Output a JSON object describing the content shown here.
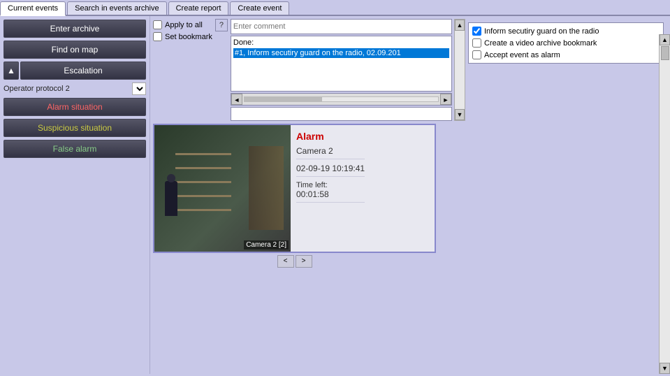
{
  "tabs": [
    {
      "label": "Current events",
      "active": true
    },
    {
      "label": "Search in events archive",
      "active": false
    },
    {
      "label": "Create report",
      "active": false
    },
    {
      "label": "Create event",
      "active": false
    }
  ],
  "left_panel": {
    "enter_archive": "Enter archive",
    "find_on_map": "Find on map",
    "escalation": "Escalation",
    "protocol_label": "Operator protocol 2",
    "alarm_situation": "Alarm situation",
    "suspicious_situation": "Suspicious situation",
    "false_alarm": "False alarm"
  },
  "middle_panel": {
    "apply_to_all": "Apply to all",
    "set_bookmark": "Set bookmark",
    "help_text": "?",
    "comment_placeholder": "Enter comment",
    "done_label": "Done:",
    "done_text": "#1, Inform secutiry guard on the radio, 02.09.201"
  },
  "right_panel": {
    "items": [
      {
        "label": "Inform secutiry guard on the radio",
        "checked": true
      },
      {
        "label": "Create a video archive bookmark",
        "checked": false
      },
      {
        "label": "Accept event as alarm",
        "checked": false
      }
    ]
  },
  "event_card": {
    "alarm_label": "Alarm",
    "camera_name": "Camera 2",
    "datetime": "02-09-19 10:19:41",
    "time_left_label": "Time left:",
    "time_left_value": "00:01:58",
    "camera_label": "Camera 2 [2]",
    "nav_prev": "<",
    "nav_next": ">"
  }
}
